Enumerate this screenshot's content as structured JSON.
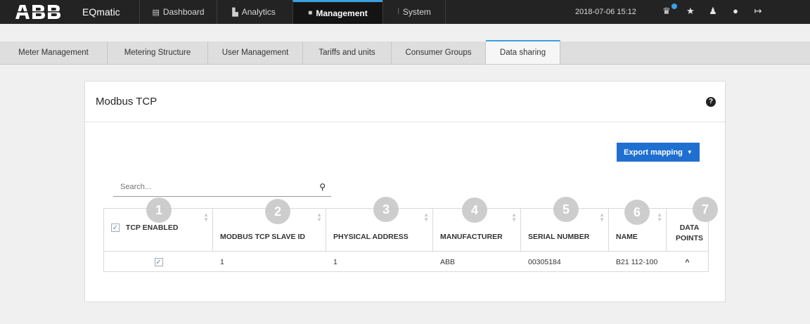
{
  "header": {
    "logo": "ABB",
    "app_name": "EQmatic",
    "nav": [
      {
        "label": "Dashboard",
        "icon": "dashboard-icon",
        "glyph": "▤"
      },
      {
        "label": "Analytics",
        "icon": "analytics-icon",
        "glyph": "▙"
      },
      {
        "label": "Management",
        "icon": "lock-icon",
        "glyph": "🔒"
      },
      {
        "label": "System",
        "icon": "sliders-icon",
        "glyph": "⫶"
      }
    ],
    "active_nav": "Management",
    "datetime": "2018-07-06 15:12",
    "icons": [
      "bell-icon",
      "star-icon",
      "user-icon",
      "info-icon",
      "logout-icon"
    ],
    "accent_color": "#3aa0e0"
  },
  "subnav": {
    "tabs": [
      "Meter Management",
      "Metering Structure",
      "User Management",
      "Tariffs and units",
      "Consumer Groups",
      "Data sharing"
    ],
    "active": "Data sharing"
  },
  "panel": {
    "title": "Modbus TCP",
    "help_glyph": "?",
    "export_label": "Export mapping",
    "export_color": "#1f6fd1",
    "search_placeholder": "Search...",
    "table": {
      "select_all_checked": true,
      "columns": [
        "TCP ENABLED",
        "MODBUS TCP SLAVE ID",
        "PHYSICAL ADDRESS",
        "MANUFACTURER",
        "SERIAL NUMBER",
        "NAME",
        "DATA POINTS"
      ],
      "rows": [
        {
          "tcp_enabled": true,
          "slave_id": "1",
          "physical_address": "1",
          "manufacturer": "ABB",
          "serial_number": "00305184",
          "name": "B21 112-100",
          "data_points": "^"
        }
      ]
    },
    "badges": [
      "1",
      "2",
      "3",
      "4",
      "5",
      "6",
      "7"
    ]
  }
}
